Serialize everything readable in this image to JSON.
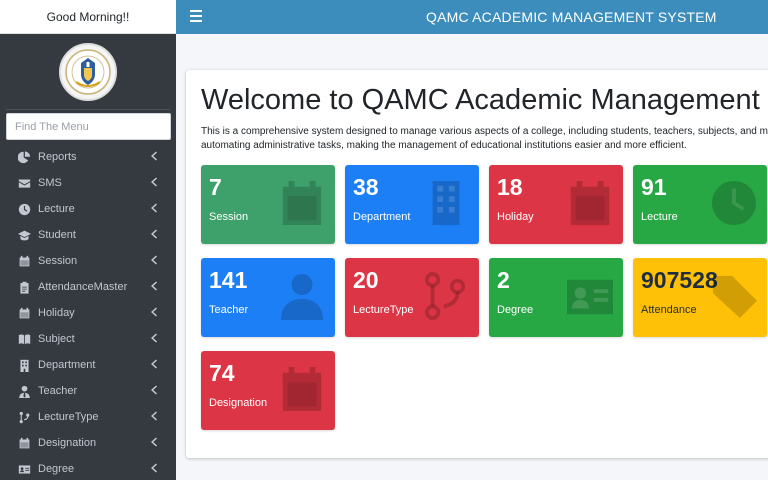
{
  "sidebar": {
    "greeting": "Good Morning!!",
    "logo_name": "college-logo",
    "search_placeholder": "Find The Menu",
    "items": [
      {
        "label": "Reports",
        "icon": "pie-chart-icon"
      },
      {
        "label": "SMS",
        "icon": "envelope-icon"
      },
      {
        "label": "Lecture",
        "icon": "clock-icon"
      },
      {
        "label": "Student",
        "icon": "graduation-cap-icon"
      },
      {
        "label": "Session",
        "icon": "calendar-icon"
      },
      {
        "label": "AttendanceMaster",
        "icon": "clipboard-icon"
      },
      {
        "label": "Holiday",
        "icon": "calendar-icon"
      },
      {
        "label": "Subject",
        "icon": "book-icon"
      },
      {
        "label": "Department",
        "icon": "building-icon"
      },
      {
        "label": "Teacher",
        "icon": "user-tie-icon"
      },
      {
        "label": "LectureType",
        "icon": "code-branch-icon"
      },
      {
        "label": "Designation",
        "icon": "calendar-icon"
      },
      {
        "label": "Degree",
        "icon": "id-card-icon"
      }
    ]
  },
  "header": {
    "title": "QAMC ACADEMIC MANAGEMENT SYSTEM"
  },
  "main": {
    "welcome": "Welcome to QAMC Academic Management System",
    "description": "This is a comprehensive system designed to manage various aspects of a college, including students, teachers, subjects, and more, automating administrative tasks, making the management of educational institutions easier and more efficient.",
    "tiles": [
      {
        "value": "7",
        "label": "Session",
        "icon": "calendar-icon",
        "color": "#3ea06b"
      },
      {
        "value": "38",
        "label": "Department",
        "icon": "building-icon",
        "color": "#1d7ff5"
      },
      {
        "value": "18",
        "label": "Holiday",
        "icon": "calendar-icon",
        "color": "#dc3545"
      },
      {
        "value": "91",
        "label": "Lecture",
        "icon": "clock-icon",
        "color": "#28a745"
      },
      {
        "value": "141",
        "label": "Teacher",
        "icon": "user-tie-icon",
        "color": "#1d7ff5"
      },
      {
        "value": "20",
        "label": "LectureType",
        "icon": "code-branch-icon",
        "color": "#dc3545"
      },
      {
        "value": "2",
        "label": "Degree",
        "icon": "id-card-icon",
        "color": "#28a745"
      },
      {
        "value": "907528",
        "label": "Attendance",
        "icon": "tag-icon",
        "color": "#ffc107"
      },
      {
        "value": "74",
        "label": "Designation",
        "icon": "calendar-icon",
        "color": "#dc3545"
      }
    ]
  }
}
